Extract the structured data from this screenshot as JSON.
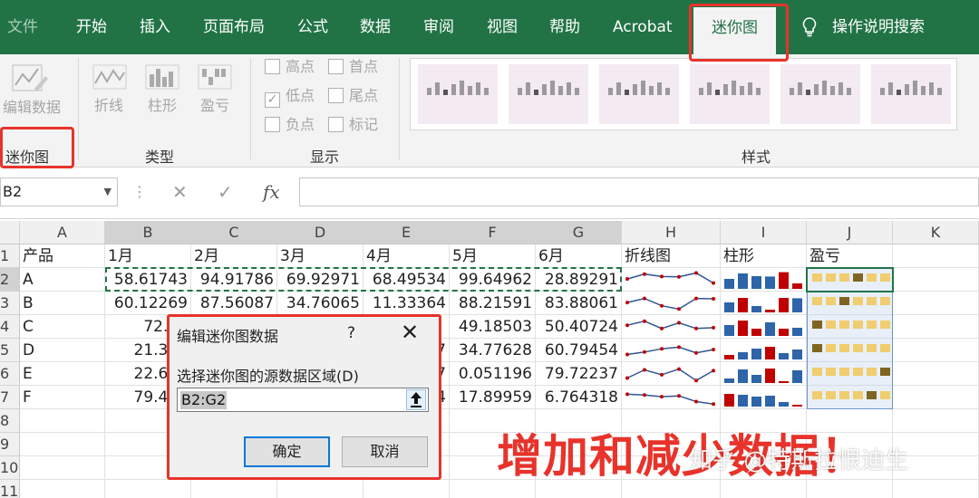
{
  "tabs": [
    "文件",
    "开始",
    "插入",
    "页面布局",
    "公式",
    "数据",
    "审阅",
    "视图",
    "帮助",
    "Acrobat",
    "迷你图"
  ],
  "tell_me": "操作说明搜索",
  "ribbon": {
    "edit_data": "编辑数据",
    "group_sparkline": "迷你图",
    "type_line": "折线",
    "type_column": "柱形",
    "type_winloss": "盈亏",
    "group_type": "类型",
    "show": [
      "高点",
      "首点",
      "低点",
      "尾点",
      "负点",
      "标记"
    ],
    "group_show": "显示",
    "group_style": "样式"
  },
  "formula_bar": {
    "name_box": "B2",
    "cancel": "✕",
    "enter": "✓",
    "fx": "fx"
  },
  "columns": [
    "A",
    "B",
    "C",
    "D",
    "E",
    "F",
    "G",
    "H",
    "I",
    "J",
    "K"
  ],
  "rows": [
    "1",
    "2",
    "3",
    "4",
    "5",
    "6",
    "7",
    "8",
    "9",
    "10",
    "11"
  ],
  "sheet": {
    "headers": [
      "产品",
      "1月",
      "2月",
      "3月",
      "4月",
      "5月",
      "6月",
      "折线图",
      "柱形",
      "盈亏"
    ],
    "data": [
      [
        "A",
        "58.61743",
        "94.91786",
        "69.92971",
        "68.49534",
        "99.64962",
        "28.89291"
      ],
      [
        "B",
        "60.12269",
        "87.56087",
        "34.76065",
        "11.33364",
        "88.21591",
        "83.88061"
      ],
      [
        "C",
        "72.57",
        "",
        "",
        "",
        "49.18503",
        "50.40724"
      ],
      [
        "D",
        "21.395",
        "",
        "",
        "7",
        "34.77628",
        "60.79454"
      ],
      [
        "E",
        "22.604",
        "",
        "",
        "7",
        "0.051196",
        "79.72237"
      ],
      [
        "F",
        "79.452",
        "",
        "",
        "4",
        "17.89959",
        "6.764318"
      ]
    ]
  },
  "dialog": {
    "title": "编辑迷你图数据",
    "help": "?",
    "close": "✕",
    "label": "选择迷你图的源数据区域(D)",
    "value": "B2:G2",
    "collapse": "🡅",
    "ok": "确定",
    "cancel": "取消"
  },
  "annotation": "增加和减少数据！",
  "watermark": "知乎 @特斯拉恨迪生",
  "colors": {
    "brand": "#217346",
    "highlight": "#e8332b",
    "spark_line": "#2f5597",
    "spark_marker": "#c00000",
    "column_blue": "#2e64a8",
    "column_red": "#c00000",
    "winloss_gold": "#f0cd6e",
    "winloss_dark": "#7f6520"
  }
}
